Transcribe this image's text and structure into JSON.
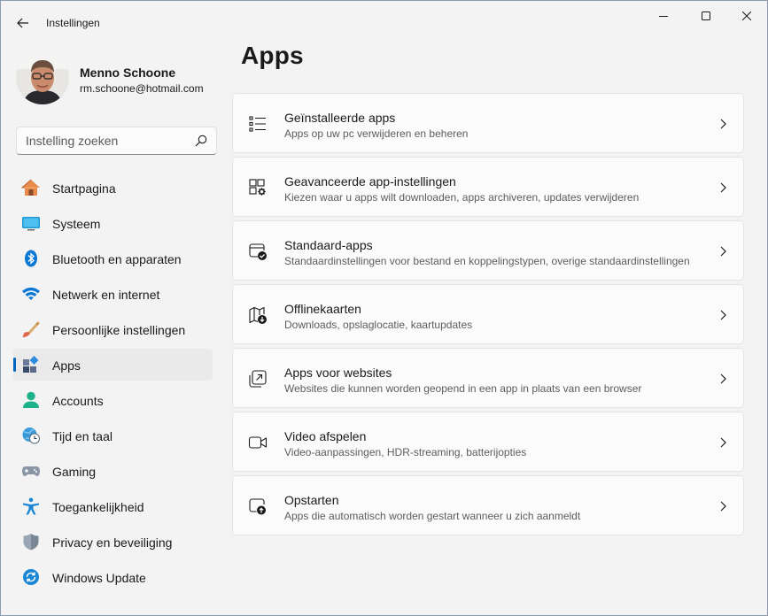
{
  "window": {
    "title": "Instellingen"
  },
  "profile": {
    "name": "Menno Schoone",
    "email": "rm.schoone@hotmail.com"
  },
  "search": {
    "placeholder": "Instelling zoeken"
  },
  "nav": {
    "items": [
      {
        "label": "Startpagina",
        "icon": "home-icon"
      },
      {
        "label": "Systeem",
        "icon": "system-icon"
      },
      {
        "label": "Bluetooth en apparaten",
        "icon": "bluetooth-icon"
      },
      {
        "label": "Netwerk en internet",
        "icon": "wifi-icon"
      },
      {
        "label": "Persoonlijke instellingen",
        "icon": "brush-icon"
      },
      {
        "label": "Apps",
        "icon": "apps-icon",
        "selected": true
      },
      {
        "label": "Accounts",
        "icon": "person-icon"
      },
      {
        "label": "Tijd en taal",
        "icon": "globe-clock-icon"
      },
      {
        "label": "Gaming",
        "icon": "gamepad-icon"
      },
      {
        "label": "Toegankelijkheid",
        "icon": "accessibility-icon"
      },
      {
        "label": "Privacy en beveiliging",
        "icon": "shield-icon"
      },
      {
        "label": "Windows Update",
        "icon": "update-icon"
      }
    ]
  },
  "main": {
    "title": "Apps",
    "cards": [
      {
        "title": "Geïnstalleerde apps",
        "description": "Apps op uw pc verwijderen en beheren",
        "icon": "app-list-icon"
      },
      {
        "title": "Geavanceerde app-instellingen",
        "description": "Kiezen waar u apps wilt downloaden, apps archiveren, updates verwijderen",
        "icon": "app-settings-icon"
      },
      {
        "title": "Standaard-apps",
        "description": "Standaardinstellingen voor bestand en koppelingstypen, overige standaardinstellingen",
        "icon": "default-apps-icon"
      },
      {
        "title": "Offlinekaarten",
        "description": "Downloads, opslaglocatie, kaartupdates",
        "icon": "offline-map-icon"
      },
      {
        "title": "Apps voor websites",
        "description": "Websites die kunnen worden geopend in een app in plaats van een browser",
        "icon": "open-in-app-icon"
      },
      {
        "title": "Video afspelen",
        "description": "Video-aanpassingen, HDR-streaming, batterijopties",
        "icon": "video-icon"
      },
      {
        "title": "Opstarten",
        "description": "Apps die automatisch worden gestart wanneer u zich aanmeldt",
        "icon": "startup-icon"
      }
    ]
  },
  "colors": {
    "accent": "#0067c0",
    "background": "#f3f3f3",
    "card": "#fbfbfb"
  }
}
